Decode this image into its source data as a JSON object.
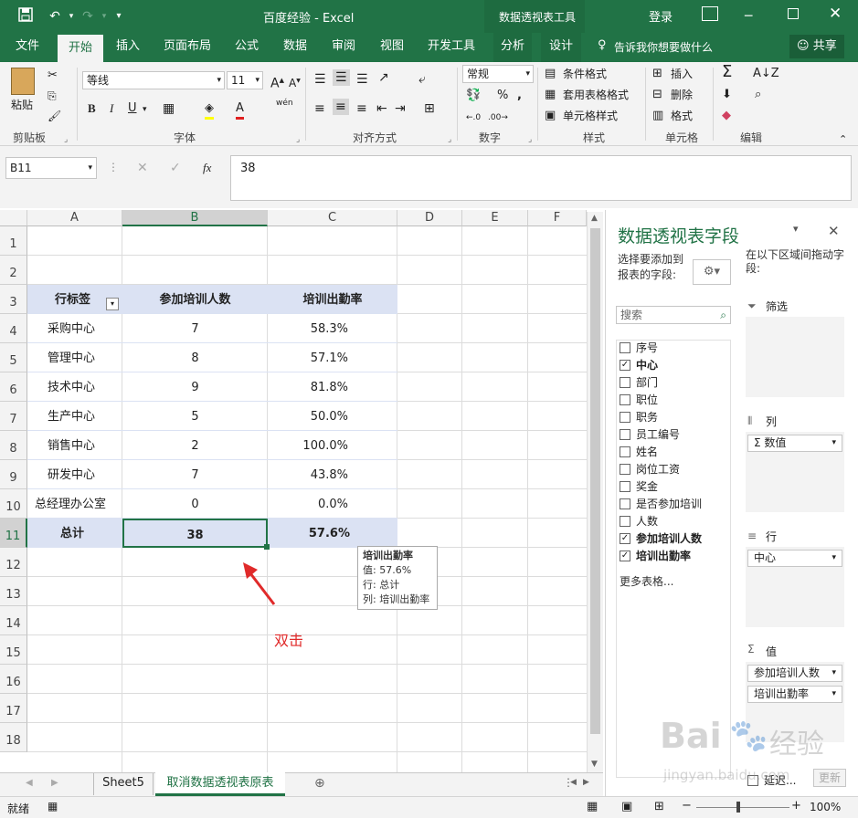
{
  "window": {
    "title": "百度经验  -  Excel",
    "context_title": "数据透视表工具",
    "login": "登录"
  },
  "tabs": [
    "文件",
    "开始",
    "插入",
    "页面布局",
    "公式",
    "数据",
    "审阅",
    "视图",
    "开发工具",
    "分析",
    "设计"
  ],
  "tell_me": "告诉我你想要做什么",
  "share": "共享",
  "ribbon": {
    "paste": "粘贴",
    "clipboard": "剪贴板",
    "font_name": "等线",
    "font_size": "11",
    "font": "字体",
    "alignment": "对齐方式",
    "number_format": "常规",
    "number": "数字",
    "cond_format": "条件格式",
    "table_format": "套用表格格式",
    "cell_style": "单元格样式",
    "styles": "样式",
    "insert": "插入",
    "delete": "删除",
    "format": "格式",
    "cells": "单元格",
    "editing": "编辑",
    "bold": "B",
    "italic": "I",
    "underline": "U",
    "wen": "wén"
  },
  "formula": {
    "namebox": "B11",
    "fx": "fx",
    "value": "38"
  },
  "columns": [
    "A",
    "B",
    "C",
    "D",
    "E",
    "F"
  ],
  "rows": [
    "1",
    "2",
    "3",
    "4",
    "5",
    "6",
    "7",
    "8",
    "9",
    "10",
    "11",
    "12",
    "13",
    "14",
    "15",
    "16",
    "17",
    "18"
  ],
  "pivot": {
    "header": {
      "label": "行标签",
      "count": "参加培训人数",
      "rate": "培训出勤率"
    },
    "items": [
      {
        "label": "采购中心",
        "count": "7",
        "rate": "58.3%"
      },
      {
        "label": "管理中心",
        "count": "8",
        "rate": "57.1%"
      },
      {
        "label": "技术中心",
        "count": "9",
        "rate": "81.8%"
      },
      {
        "label": "生产中心",
        "count": "5",
        "rate": "50.0%"
      },
      {
        "label": "销售中心",
        "count": "2",
        "rate": "100.0%"
      },
      {
        "label": "研发中心",
        "count": "7",
        "rate": "43.8%"
      },
      {
        "label": "总经理办公室",
        "count": "0",
        "rate": "0.0%"
      }
    ],
    "total": {
      "label": "总计",
      "count": "38",
      "rate": "57.6%"
    }
  },
  "tooltip": {
    "title": "培训出勤率",
    "value": "值: 57.6%",
    "row": "行: 总计",
    "col": "列:  培训出勤率"
  },
  "annotation": "双击",
  "sheets": [
    "Sheet5",
    "取消数据透视表原表"
  ],
  "status": {
    "ready": "就绪",
    "zoom": "100%"
  },
  "panel": {
    "title": "数据透视表字段",
    "choose": "选择要添加到报表的字段:",
    "drag": "在以下区域间拖动字段:",
    "search": "搜索",
    "fields": [
      {
        "name": "序号",
        "checked": false
      },
      {
        "name": "中心",
        "checked": true
      },
      {
        "name": "部门",
        "checked": false
      },
      {
        "name": "职位",
        "checked": false
      },
      {
        "name": "职务",
        "checked": false
      },
      {
        "name": "员工编号",
        "checked": false
      },
      {
        "name": "姓名",
        "checked": false
      },
      {
        "name": "岗位工资",
        "checked": false
      },
      {
        "name": "奖金",
        "checked": false
      },
      {
        "name": "是否参加培训",
        "checked": false
      },
      {
        "name": "人数",
        "checked": false
      },
      {
        "name": "参加培训人数",
        "checked": true
      },
      {
        "name": "培训出勤率",
        "checked": true
      }
    ],
    "more": "更多表格...",
    "filter": "筛选",
    "columns": "列",
    "columns_item": "Σ  数值",
    "rows": "行",
    "rows_item": "中心",
    "values": "值",
    "values_items": [
      "参加培训人数",
      "培训出勤率"
    ],
    "defer": "延迟...",
    "update": "更新"
  },
  "watermark": {
    "brand": "Bai",
    "brand2": "经验",
    "url": "jingyan.baidu.com"
  }
}
